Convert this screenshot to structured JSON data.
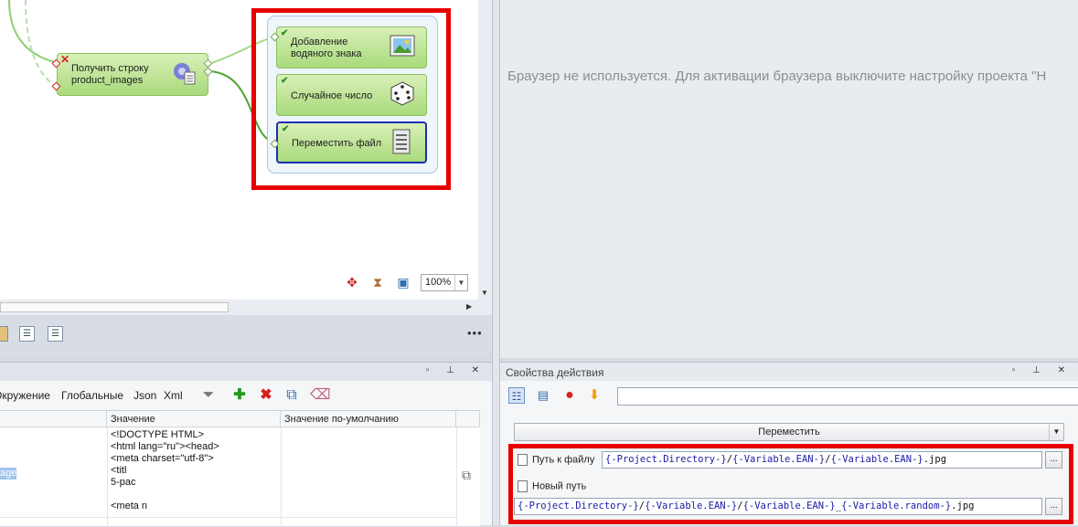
{
  "canvas": {
    "node_get_line": {
      "label": "Получить строку product_images",
      "line1": "Получить строку",
      "line2": "product_images"
    },
    "group_nodes": [
      {
        "line1": "Добавление",
        "line2": "водяного знака"
      },
      {
        "line1": "Случайное число",
        "line2": ""
      },
      {
        "line1": "Переместить файл",
        "line2": ""
      }
    ],
    "zoom_value": "100%"
  },
  "browser": {
    "message": "Браузер не используется. Для активации браузера выключите настройку проекта \"Н"
  },
  "variables_panel": {
    "tabs": [
      "Окружение",
      "Глобальные",
      "Json",
      "Xml"
    ],
    "columns": [
      "Значение",
      "Значение по-умолчанию"
    ],
    "left_fragment": "age",
    "value_lines": [
      "<!DOCTYPE HTML>",
      "<html lang=\"ru\"><head>",
      "<meta charset=\"utf-8\">",
      "<titl",
      "5-pac",
      "<meta n"
    ]
  },
  "properties_panel": {
    "title": "Свойства действия",
    "action": "Переместить",
    "file_path_label": "Путь к файлу",
    "new_path_label": "Новый путь",
    "dots": "...",
    "file_path_tokens": [
      {
        "t": "{-Project.Directory-}",
        "c": "blue"
      },
      {
        "t": "/",
        "c": "black"
      },
      {
        "t": "{-Variable.EAN-}",
        "c": "blue"
      },
      {
        "t": "/",
        "c": "black"
      },
      {
        "t": "{-Variable.EAN-}",
        "c": "blue"
      },
      {
        "t": ".jpg",
        "c": "black"
      }
    ],
    "new_path_tokens": [
      {
        "t": "{-Project.Directory-}",
        "c": "blue"
      },
      {
        "t": "/",
        "c": "black"
      },
      {
        "t": "{-Variable.EAN-}",
        "c": "blue"
      },
      {
        "t": "/",
        "c": "black"
      },
      {
        "t": "{-Variable.EAN-}",
        "c": "blue"
      },
      {
        "t": "_",
        "c": "black"
      },
      {
        "t": "{-Variable.random-}",
        "c": "blue"
      },
      {
        "t": ".jpg",
        "c": "black"
      }
    ]
  },
  "colors": {
    "highlight": "#e60000",
    "node_green": "#a9da7c",
    "link_blue": "#1a1aa6"
  }
}
